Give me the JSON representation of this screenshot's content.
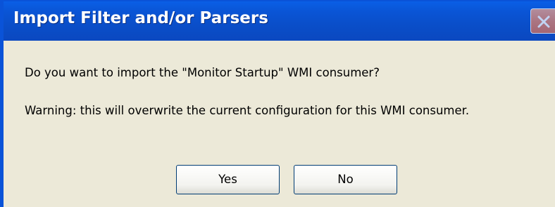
{
  "dialog": {
    "title": "Import Filter and/or Parsers",
    "question": "Do you want to import the \"Monitor Startup\" WMI consumer?",
    "warning": "Warning: this will overwrite the current configuration for this WMI consumer.",
    "buttons": {
      "yes": "Yes",
      "no": "No"
    },
    "close_icon": "close-icon"
  },
  "colors": {
    "titlebar": "#0a53d8",
    "dialog_background": "#ece9d8",
    "close_button": "#e1826a",
    "button_border": "#003c74"
  }
}
